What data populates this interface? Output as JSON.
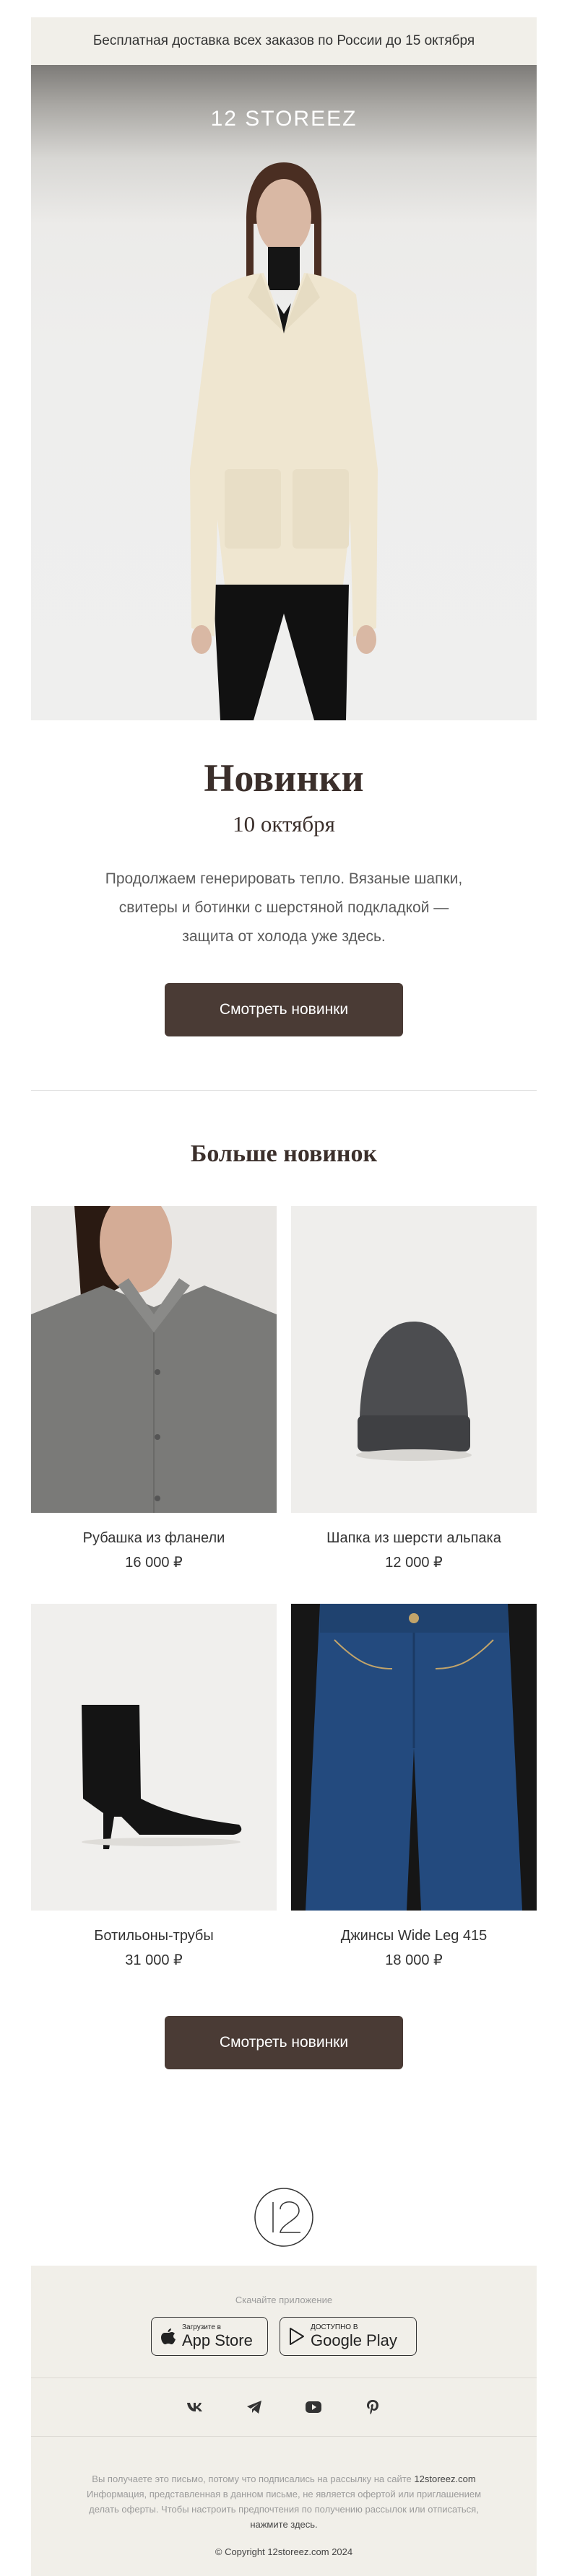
{
  "topbar": {
    "text": "Бесплатная доставка всех заказов по России до 15 октября"
  },
  "hero": {
    "logo": "12 STOREEZ"
  },
  "intro": {
    "title": "Новинки",
    "date": "10 октября",
    "text": "Продолжаем генерировать тепло. Вязаные шапки, свитеры и ботинки с шерстяной подкладкой — защита от холода уже здесь.",
    "cta": "Смотреть новинки"
  },
  "more": {
    "title": "Больше новинок",
    "products": [
      {
        "name": "Рубашка из фланели",
        "price": "16 000 ₽"
      },
      {
        "name": "Шапка из шерсти альпака",
        "price": "12 000 ₽"
      },
      {
        "name": "Ботильоны-трубы",
        "price": "31 000 ₽"
      },
      {
        "name": "Джинсы Wide Leg 415",
        "price": "18 000 ₽"
      }
    ],
    "cta": "Смотреть новинки"
  },
  "footer": {
    "apps_label": "Скачайте приложение",
    "appstore_small": "Загрузите в",
    "appstore_big": "App Store",
    "gplay_small": "ДОСТУПНО В",
    "gplay_big": "Google Play",
    "social": [
      "vk-icon",
      "telegram-icon",
      "youtube-icon",
      "pinterest-icon"
    ],
    "legal_1": "Вы получаете это письмо, потому что подписались на рассылку на сайте",
    "legal_site": "12storeez.com",
    "legal_2": "Информация, представленная в данном письме, не является офертой или приглашением делать оферты. Чтобы настроить предпочтения по получению рассылок или отписаться,",
    "legal_link": "нажмите здесь.",
    "copyright": "© Copyright 12storeez.com 2024"
  },
  "colors": {
    "accent": "#4a3b35",
    "beige": "#f1efe9",
    "title": "#3b2f2b"
  }
}
